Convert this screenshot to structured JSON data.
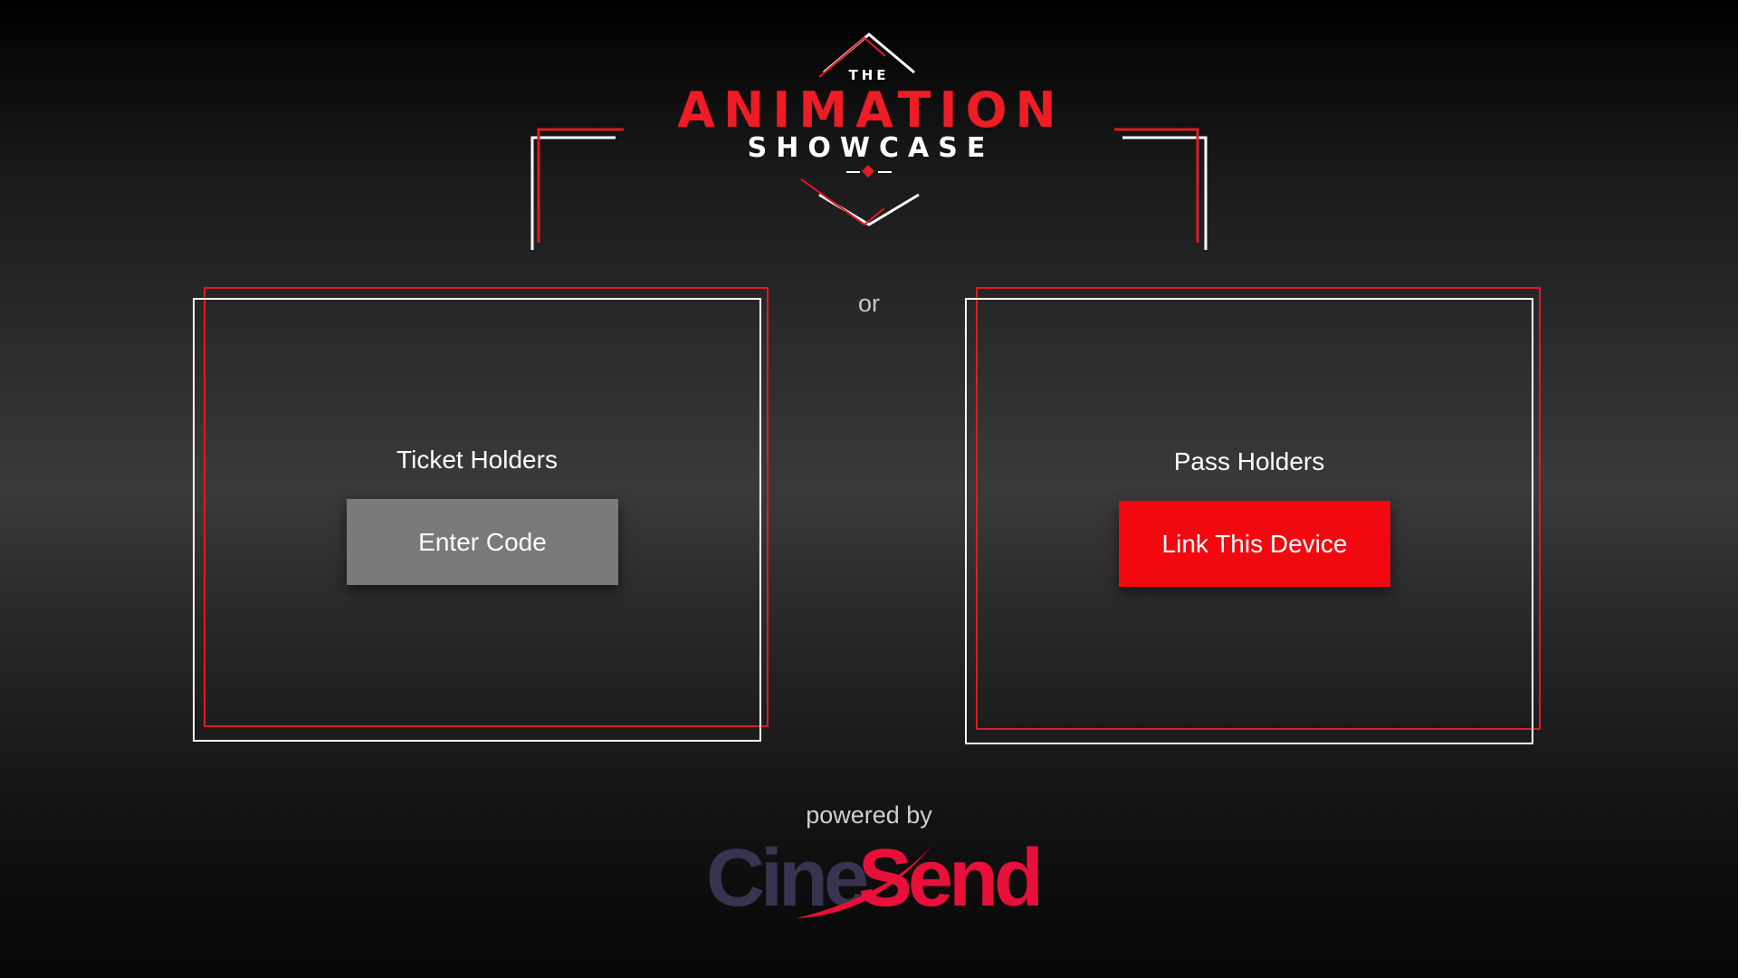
{
  "logo": {
    "line1": "THE",
    "line2": "ANIMATION",
    "line3": "SHOWCASE"
  },
  "separator": "or",
  "ticket_panel": {
    "title": "Ticket Holders",
    "button_label": "Enter Code"
  },
  "pass_panel": {
    "title": "Pass Holders",
    "button_label": "Link This Device"
  },
  "footer": {
    "powered_by": "powered by",
    "brand_part1": "Cine",
    "brand_part2": "Send"
  },
  "colors": {
    "accent_red": "#f4080f",
    "logo_red": "#ee1c25",
    "button_gray": "#7a7a7a",
    "brand_dark": "#3a3350",
    "brand_red": "#e8103a"
  }
}
